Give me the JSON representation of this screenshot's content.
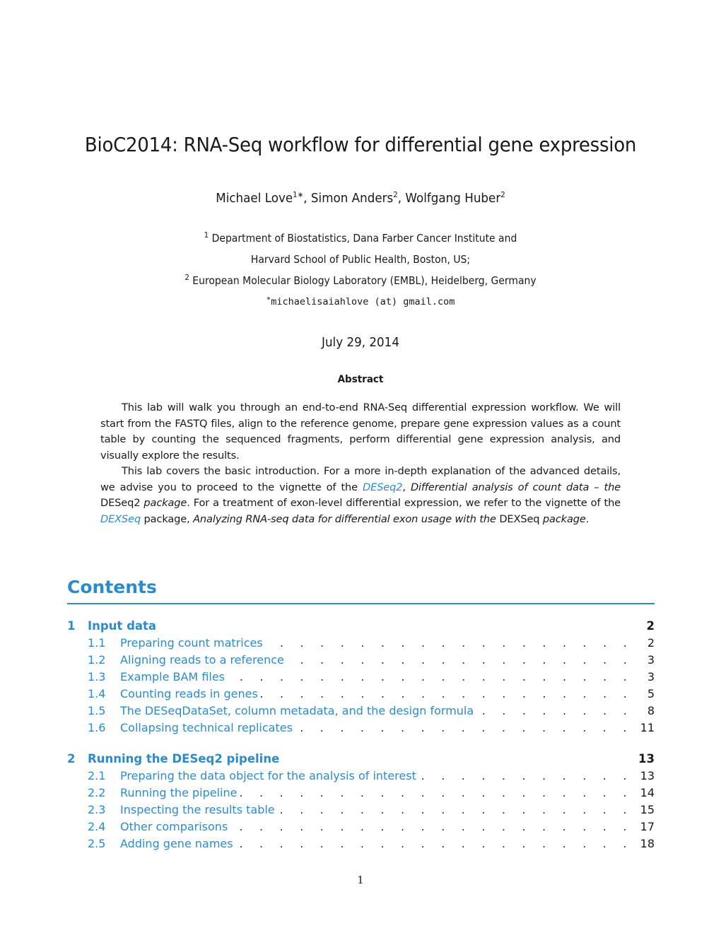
{
  "document": {
    "title": "BioC2014: RNA-Seq workflow for differential gene expression",
    "authors": [
      {
        "name": "Michael Love",
        "sup": "1∗"
      },
      {
        "name": "Simon Anders",
        "sup": "2"
      },
      {
        "name": "Wolfgang Huber",
        "sup": "2"
      }
    ],
    "affiliations": {
      "line1_sup": "1",
      "line1": "Department of Biostatistics, Dana Farber Cancer Institute and",
      "line2": "Harvard School of Public Health, Boston, US;",
      "line3_sup": "2",
      "line3": "European Molecular Biology Laboratory (EMBL), Heidelberg, Germany"
    },
    "email_sup": "∗",
    "email": "michaelisaiahlove (at) gmail.com",
    "date": "July 29, 2014",
    "abstract": {
      "heading": "Abstract",
      "paragraph1": "This lab will walk you through an end-to-end RNA-Seq differential expression workflow. We will start from the FASTQ files, align to the reference genome, prepare gene expression values as a count table by counting the sequenced fragments, perform differential gene expression analysis, and visually explore the results.",
      "paragraph2": {
        "t1": "This lab covers the basic introduction.  For a more in-depth explanation of the advanced details, we advise you to proceed to the vignette of the ",
        "link1": "DESeq2",
        "t2": ", ",
        "i1": "Differential analysis of count data – the",
        "t3": " DESeq2 ",
        "i2": "package",
        "t4": ". For a treatment of exon-level differential expression, we refer to the vignette of the ",
        "link2": "DEXSeq",
        "t5": " package, ",
        "i3": "Analyzing RNA-seq data for differential exon usage with the",
        "t6": " DEXSeq ",
        "i4": "package",
        "t7": "."
      }
    },
    "contents": {
      "heading": "Contents",
      "sections": [
        {
          "number": "1",
          "label": "Input data",
          "page": "2",
          "subsections": [
            {
              "number": "1.1",
              "label": "Preparing count matrices",
              "page": "2"
            },
            {
              "number": "1.2",
              "label": "Aligning reads to a reference",
              "page": "3"
            },
            {
              "number": "1.3",
              "label": "Example BAM files",
              "page": "3"
            },
            {
              "number": "1.4",
              "label": "Counting reads in genes",
              "page": "5"
            },
            {
              "number": "1.5",
              "label": "The DESeqDataSet, column metadata, and the design formula",
              "page": "8"
            },
            {
              "number": "1.6",
              "label": "Collapsing technical replicates",
              "page": "11"
            }
          ]
        },
        {
          "number": "2",
          "label": "Running the DESeq2 pipeline",
          "page": "13",
          "subsections": [
            {
              "number": "2.1",
              "label": "Preparing the data object for the analysis of interest",
              "page": "13"
            },
            {
              "number": "2.2",
              "label": "Running the pipeline",
              "page": "14"
            },
            {
              "number": "2.3",
              "label": "Inspecting the results table",
              "page": "15"
            },
            {
              "number": "2.4",
              "label": "Other comparisons",
              "page": "17"
            },
            {
              "number": "2.5",
              "label": "Adding gene names",
              "page": "18"
            }
          ]
        }
      ],
      "leader": ". . . . . . . . . . . . . . . . . . . . . . . . . . . . . . . . . . . . . . . . . . . . . . . . . . . . . . . . . . . . ."
    },
    "page_number": "1",
    "colors": {
      "link_blue": "#2c8bcb",
      "text": "#1a1a1a"
    }
  }
}
